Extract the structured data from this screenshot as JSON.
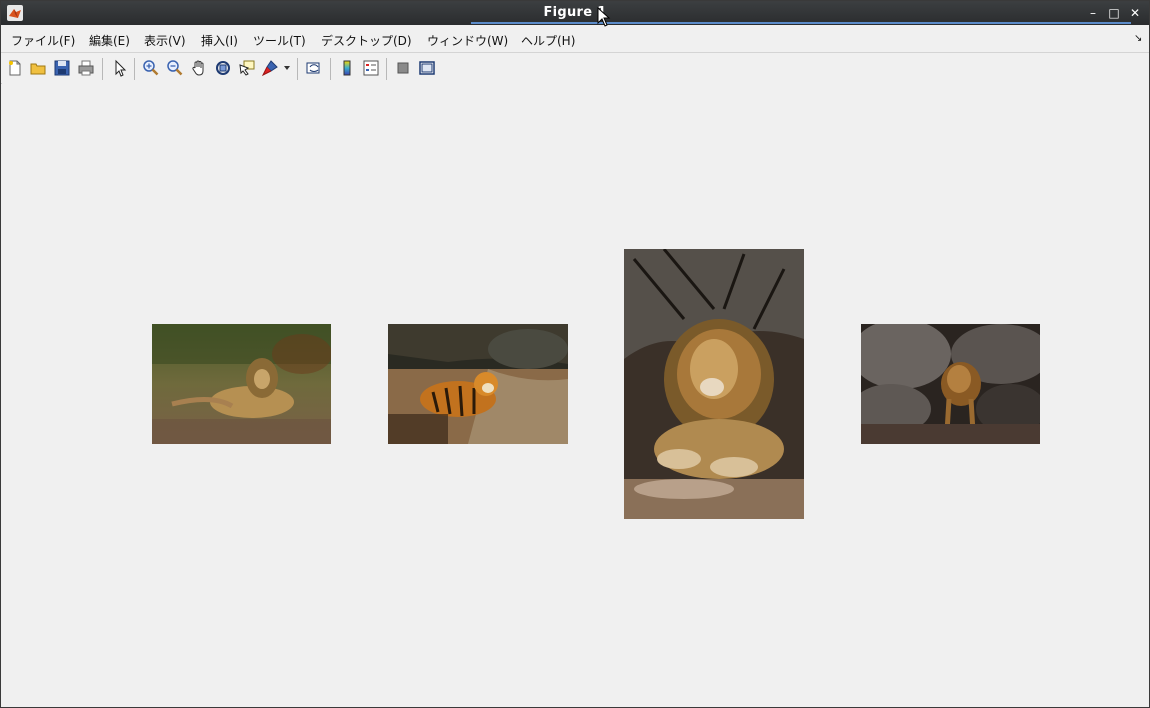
{
  "window": {
    "title": "Figure 1",
    "controls": {
      "minimize": "–",
      "maximize": "□",
      "close": "✕"
    }
  },
  "menu": {
    "items": [
      {
        "label": "ファイル(F)"
      },
      {
        "label": "編集(E)"
      },
      {
        "label": "表示(V)"
      },
      {
        "label": "挿入(I)"
      },
      {
        "label": "ツール(T)"
      },
      {
        "label": "デスクトップ(D)"
      },
      {
        "label": "ウィンドウ(W)"
      },
      {
        "label": "ヘルプ(H)"
      }
    ],
    "dock_arrow": "↘"
  },
  "toolbar": {
    "icons": [
      "new-figure-icon",
      "open-file-icon",
      "save-icon",
      "print-icon",
      "edit-plot-icon",
      "zoom-in-icon",
      "zoom-out-icon",
      "pan-icon",
      "rotate-3d-icon",
      "data-cursor-icon",
      "brush-icon",
      "brush-dropdown-icon",
      "link-plot-icon",
      "colorbar-icon",
      "legend-icon",
      "hide-plot-tools-icon",
      "show-plot-tools-icon"
    ]
  },
  "figure": {
    "images": [
      {
        "subject": "lion lying in grass"
      },
      {
        "subject": "tiger in water"
      },
      {
        "subject": "lion sitting portrait"
      },
      {
        "subject": "lion on rocks"
      }
    ]
  }
}
